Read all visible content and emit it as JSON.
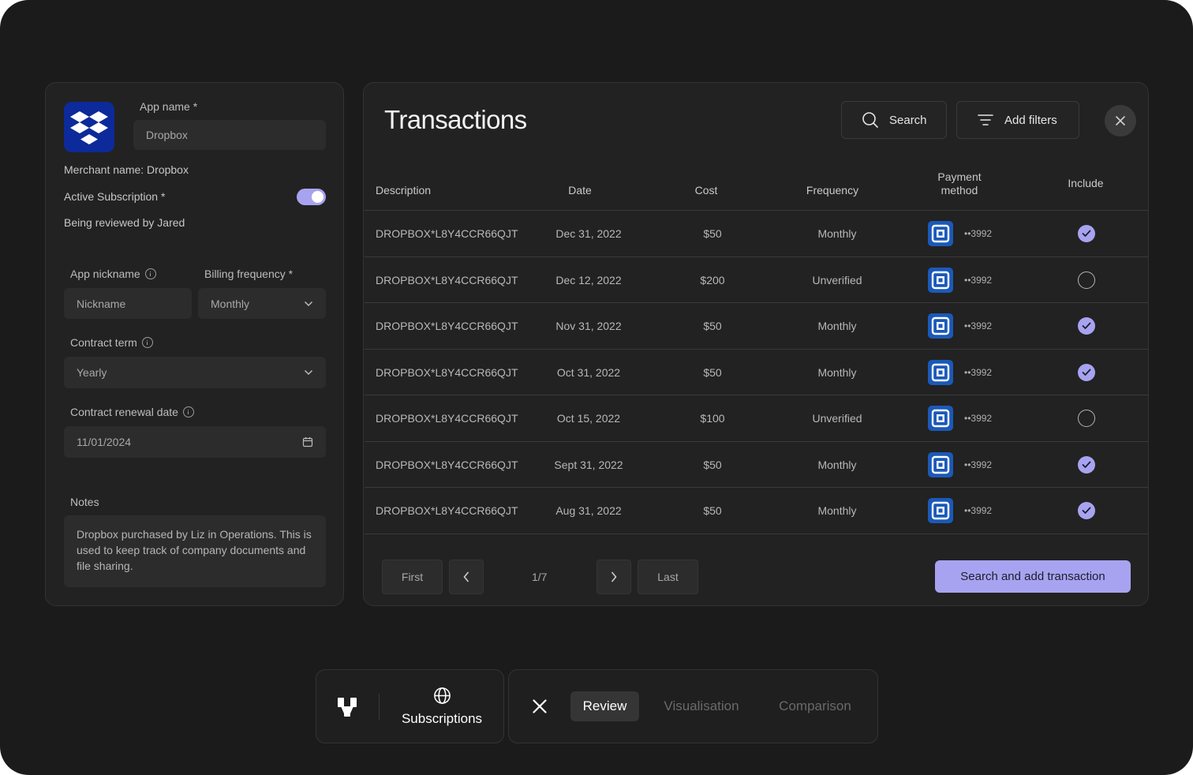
{
  "left": {
    "app_name_label": "App name *",
    "app_name_value": "Dropbox",
    "merchant_name": "Merchant name: Dropbox",
    "active_subscription_label": "Active Subscription *",
    "active_subscription_on": true,
    "reviewed_by": "Being reviewed by Jared",
    "nickname_label": "App nickname",
    "nickname_placeholder": "Nickname",
    "billing_label": "Billing frequency *",
    "billing_value": "Monthly",
    "contract_term_label": "Contract term",
    "contract_term_value": "Yearly",
    "renewal_label": "Contract renewal date",
    "renewal_value": "11/01/2024",
    "notes_label": "Notes",
    "notes_text": "Dropbox purchased by Liz in Operations. This is used to keep track of company documents and file sharing."
  },
  "transactions": {
    "title": "Transactions",
    "search_label": "Search",
    "filters_label": "Add filters",
    "headers": {
      "description": "Description",
      "date": "Date",
      "cost": "Cost",
      "frequency": "Frequency",
      "payment_1": "Payment",
      "payment_2": "method",
      "include": "Include"
    },
    "rows": [
      {
        "description": "DROPBOX*L8Y4CCR66QJT",
        "date": "Dec 31, 2022",
        "cost": "$50",
        "frequency": "Monthly",
        "card": "••3992",
        "included": true
      },
      {
        "description": "DROPBOX*L8Y4CCR66QJT",
        "date": "Dec 12, 2022",
        "cost": "$200",
        "frequency": "Unverified",
        "card": "••3992",
        "included": false
      },
      {
        "description": "DROPBOX*L8Y4CCR66QJT",
        "date": "Nov 31, 2022",
        "cost": "$50",
        "frequency": "Monthly",
        "card": "••3992",
        "included": true
      },
      {
        "description": "DROPBOX*L8Y4CCR66QJT",
        "date": "Oct 31, 2022",
        "cost": "$50",
        "frequency": "Monthly",
        "card": "••3992",
        "included": true
      },
      {
        "description": "DROPBOX*L8Y4CCR66QJT",
        "date": "Oct 15, 2022",
        "cost": "$100",
        "frequency": "Unverified",
        "card": "••3992",
        "included": false
      },
      {
        "description": "DROPBOX*L8Y4CCR66QJT",
        "date": "Sept 31, 2022",
        "cost": "$50",
        "frequency": "Monthly",
        "card": "••3992",
        "included": true
      },
      {
        "description": "DROPBOX*L8Y4CCR66QJT",
        "date": "Aug 31, 2022",
        "cost": "$50",
        "frequency": "Monthly",
        "card": "••3992",
        "included": true
      }
    ],
    "pager": {
      "first": "First",
      "last": "Last",
      "page": "1/7"
    },
    "add_button": "Search and add transaction"
  },
  "bottom_bar": {
    "subscriptions_label": "Subscriptions",
    "tabs": [
      {
        "label": "Review",
        "active": true
      },
      {
        "label": "Visualisation",
        "active": false
      },
      {
        "label": "Comparison",
        "active": false
      }
    ]
  },
  "colors": {
    "accent": "#a8a3f0",
    "panel": "#222222",
    "background": "#1b1b1b",
    "dropbox_blue": "#0d2a9a",
    "bank_blue": "#1b59b8"
  },
  "icons": [
    "dropbox-logo-icon",
    "info-icon",
    "chevron-down-icon",
    "calendar-icon",
    "search-icon",
    "filter-icon",
    "close-icon",
    "bank-icon",
    "check-icon",
    "chevron-left-icon",
    "chevron-right-icon",
    "brand-logo-icon",
    "globe-icon"
  ]
}
